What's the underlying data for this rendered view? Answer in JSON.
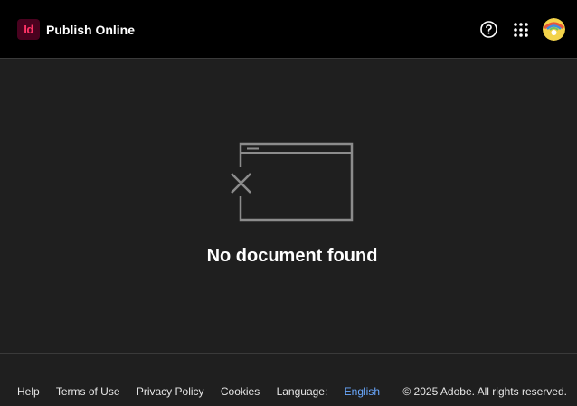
{
  "header": {
    "logo_text": "Id",
    "app_title": "Publish Online",
    "icons": {
      "help": "help-circle-icon",
      "apps": "app-grid-icon",
      "avatar": "user-avatar"
    }
  },
  "main": {
    "empty_icon": "browser-window-with-x-icon",
    "empty_message": "No document found"
  },
  "footer": {
    "links": {
      "help": "Help",
      "terms": "Terms of Use",
      "privacy": "Privacy Policy",
      "cookies": "Cookies"
    },
    "language_label": "Language:",
    "language_value": "English",
    "copyright": "© 2025 Adobe. All rights reserved."
  },
  "colors": {
    "background": "#1f1f1f",
    "topbar": "#000000",
    "logo_bg": "#49021f",
    "logo_fg": "#ff3366",
    "link_accent": "#6aa9ff"
  }
}
